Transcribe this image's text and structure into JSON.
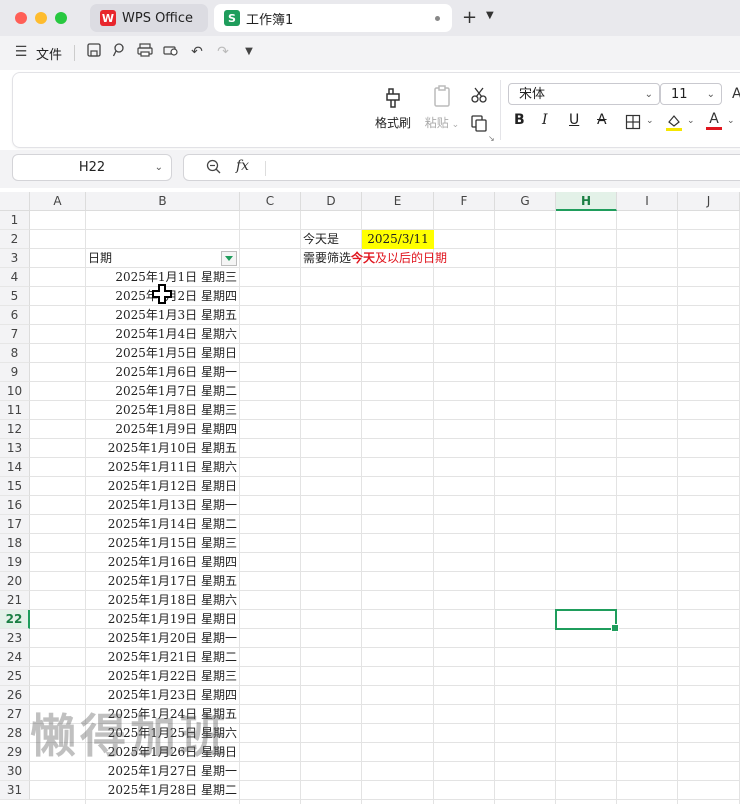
{
  "window": {
    "tabs": [
      {
        "label": "WPS Office",
        "icon": "wps-logo-icon"
      },
      {
        "label": "工作簿1",
        "icon": "spreadsheet-logo-icon"
      }
    ]
  },
  "quickbar": {
    "file_label": "文件"
  },
  "ribbon": {
    "format_painter": "格式刷",
    "paste": "粘贴",
    "font_name": "宋体",
    "font_size": "11"
  },
  "formula_bar": {
    "name_box": "H22",
    "fx_label": "fx",
    "formula": ""
  },
  "sheet": {
    "columns": [
      "A",
      "B",
      "C",
      "D",
      "E",
      "F",
      "G",
      "H",
      "I",
      "J"
    ],
    "active_column": "H",
    "active_row": 22,
    "rows": [
      "1",
      "2",
      "3",
      "4",
      "5",
      "6",
      "7",
      "8",
      "9",
      "10",
      "11",
      "12",
      "13",
      "14",
      "15",
      "16",
      "17",
      "18",
      "19",
      "20",
      "21",
      "22",
      "23",
      "24",
      "25",
      "26",
      "27",
      "28",
      "29",
      "30",
      "31"
    ],
    "d2": "今天是",
    "e2": "2025/3/11",
    "b3": "日期",
    "d3_prefix": "需要筛选",
    "d3_highlight": "今天",
    "d3_suffix": "及以后的日期",
    "dates": [
      "2025年1月1日 星期三",
      "2025年1月2日 星期四",
      "2025年1月3日 星期五",
      "2025年1月4日 星期六",
      "2025年1月5日 星期日",
      "2025年1月6日 星期一",
      "2025年1月7日 星期二",
      "2025年1月8日 星期三",
      "2025年1月9日 星期四",
      "2025年1月10日 星期五",
      "2025年1月11日 星期六",
      "2025年1月12日 星期日",
      "2025年1月13日 星期一",
      "2025年1月14日 星期二",
      "2025年1月15日 星期三",
      "2025年1月16日 星期四",
      "2025年1月17日 星期五",
      "2025年1月18日 星期六",
      "2025年1月19日 星期日",
      "2025年1月20日 星期一",
      "2025年1月21日 星期二",
      "2025年1月22日 星期三",
      "2025年1月23日 星期四",
      "2025年1月24日 星期五",
      "2025年1月25日 星期六",
      "2025年1月26日 星期日",
      "2025年1月27日 星期一",
      "2025年1月28日 星期二"
    ]
  },
  "watermark": "懒得加班",
  "colors": {
    "accent": "#1f9d5c",
    "highlight_fill": "#ffff00",
    "red_text": "#e0151e"
  }
}
